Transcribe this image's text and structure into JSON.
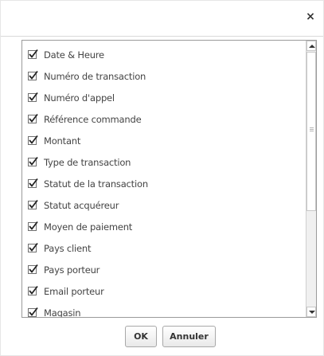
{
  "dialog": {
    "close_label": "×",
    "items": [
      {
        "label": "Date & Heure",
        "checked": true
      },
      {
        "label": "Numéro de transaction",
        "checked": true
      },
      {
        "label": "Numéro d'appel",
        "checked": true
      },
      {
        "label": "Référence commande",
        "checked": true
      },
      {
        "label": "Montant",
        "checked": true
      },
      {
        "label": "Type de transaction",
        "checked": true
      },
      {
        "label": "Statut de la transaction",
        "checked": true
      },
      {
        "label": "Statut acquéreur",
        "checked": true
      },
      {
        "label": "Moyen de paiement",
        "checked": true
      },
      {
        "label": "Pays client",
        "checked": true
      },
      {
        "label": "Pays porteur",
        "checked": true
      },
      {
        "label": "Email porteur",
        "checked": true
      },
      {
        "label": "Magasin",
        "checked": true
      }
    ],
    "ok_label": "OK",
    "cancel_label": "Annuler"
  }
}
